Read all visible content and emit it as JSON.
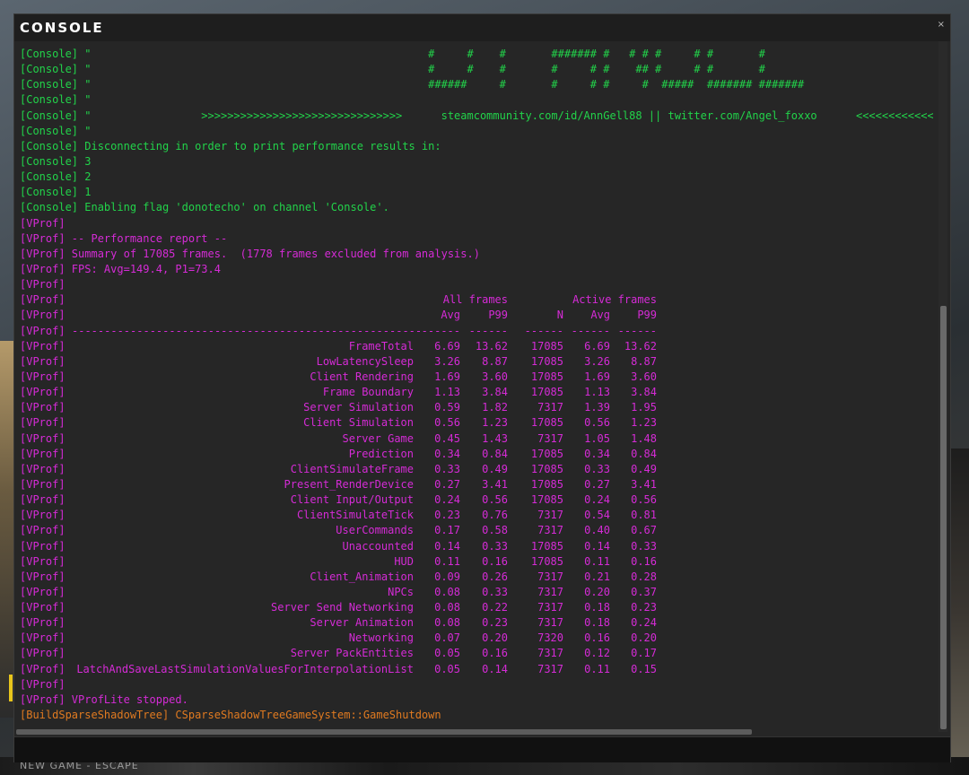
{
  "window": {
    "title": "CONSOLE",
    "close_glyph": "×"
  },
  "background": {
    "caption": "NEW GAME - ESCAPE"
  },
  "console_lines": [
    {
      "prefix": "[Console]",
      "text": " \"                                                    #     #    #       ####### #   # # #     # #       #",
      "color": "green"
    },
    {
      "prefix": "[Console]",
      "text": " \"                                                    #     #    #       #     # #    ## #     # #       #",
      "color": "green"
    },
    {
      "prefix": "[Console]",
      "text": " \"                                                    ######     #       #     # #     #  #####  ####### #######",
      "color": "green"
    },
    {
      "prefix": "[Console]",
      "text": " \"",
      "color": "green"
    },
    {
      "prefix": "[Console]",
      "text": " \"                 >>>>>>>>>>>>>>>>>>>>>>>>>>>>>>>      steamcommunity.com/id/AnnGell88 || twitter.com/Angel_foxxo      <<<<<<<<<<<<",
      "color": "green"
    },
    {
      "prefix": "[Console]",
      "text": " \"",
      "color": "green"
    },
    {
      "prefix": "[Console]",
      "text": " Disconnecting in order to print performance results in:",
      "color": "green"
    },
    {
      "prefix": "[Console]",
      "text": " 3",
      "color": "green"
    },
    {
      "prefix": "[Console]",
      "text": " 2",
      "color": "green"
    },
    {
      "prefix": "[Console]",
      "text": " 1",
      "color": "green"
    },
    {
      "prefix": "[Console]",
      "text": " Enabling flag 'donotecho' on channel 'Console'.",
      "color": "green"
    },
    {
      "prefix": "[VProf]",
      "text": "",
      "color": "mag"
    },
    {
      "prefix": "[VProf]",
      "text": " -- Performance report --",
      "color": "mag"
    },
    {
      "prefix": "[VProf]",
      "text": " Summary of 17085 frames.  (1778 frames excluded from analysis.)",
      "color": "mag"
    },
    {
      "prefix": "[VProf]",
      "text": " FPS: Avg=149.4, P1=73.4",
      "color": "mag"
    },
    {
      "prefix": "[VProf]",
      "text": "",
      "color": "mag"
    }
  ],
  "table": {
    "group_all": "All frames",
    "group_active": "Active frames",
    "headers": [
      "Avg",
      "P99",
      "N",
      "Avg",
      "P99"
    ],
    "separator_name": "------------------------------------------------------",
    "separator_col": "------",
    "rows": [
      {
        "name": "FrameTotal",
        "all_avg": "6.69",
        "all_p99": "13.62",
        "n": "17085",
        "act_avg": "6.69",
        "act_p99": "13.62"
      },
      {
        "name": "LowLatencySleep",
        "all_avg": "3.26",
        "all_p99": "8.87",
        "n": "17085",
        "act_avg": "3.26",
        "act_p99": "8.87"
      },
      {
        "name": "Client Rendering",
        "all_avg": "1.69",
        "all_p99": "3.60",
        "n": "17085",
        "act_avg": "1.69",
        "act_p99": "3.60"
      },
      {
        "name": "Frame Boundary",
        "all_avg": "1.13",
        "all_p99": "3.84",
        "n": "17085",
        "act_avg": "1.13",
        "act_p99": "3.84"
      },
      {
        "name": "Server Simulation",
        "all_avg": "0.59",
        "all_p99": "1.82",
        "n": "7317",
        "act_avg": "1.39",
        "act_p99": "1.95"
      },
      {
        "name": "Client Simulation",
        "all_avg": "0.56",
        "all_p99": "1.23",
        "n": "17085",
        "act_avg": "0.56",
        "act_p99": "1.23"
      },
      {
        "name": "Server Game",
        "all_avg": "0.45",
        "all_p99": "1.43",
        "n": "7317",
        "act_avg": "1.05",
        "act_p99": "1.48"
      },
      {
        "name": "Prediction",
        "all_avg": "0.34",
        "all_p99": "0.84",
        "n": "17085",
        "act_avg": "0.34",
        "act_p99": "0.84"
      },
      {
        "name": "ClientSimulateFrame",
        "all_avg": "0.33",
        "all_p99": "0.49",
        "n": "17085",
        "act_avg": "0.33",
        "act_p99": "0.49"
      },
      {
        "name": "Present_RenderDevice",
        "all_avg": "0.27",
        "all_p99": "3.41",
        "n": "17085",
        "act_avg": "0.27",
        "act_p99": "3.41"
      },
      {
        "name": "Client Input/Output",
        "all_avg": "0.24",
        "all_p99": "0.56",
        "n": "17085",
        "act_avg": "0.24",
        "act_p99": "0.56"
      },
      {
        "name": "ClientSimulateTick",
        "all_avg": "0.23",
        "all_p99": "0.76",
        "n": "7317",
        "act_avg": "0.54",
        "act_p99": "0.81"
      },
      {
        "name": "UserCommands",
        "all_avg": "0.17",
        "all_p99": "0.58",
        "n": "7317",
        "act_avg": "0.40",
        "act_p99": "0.67"
      },
      {
        "name": "Unaccounted",
        "all_avg": "0.14",
        "all_p99": "0.33",
        "n": "17085",
        "act_avg": "0.14",
        "act_p99": "0.33"
      },
      {
        "name": "HUD",
        "all_avg": "0.11",
        "all_p99": "0.16",
        "n": "17085",
        "act_avg": "0.11",
        "act_p99": "0.16"
      },
      {
        "name": "Client_Animation",
        "all_avg": "0.09",
        "all_p99": "0.26",
        "n": "7317",
        "act_avg": "0.21",
        "act_p99": "0.28"
      },
      {
        "name": "NPCs",
        "all_avg": "0.08",
        "all_p99": "0.33",
        "n": "7317",
        "act_avg": "0.20",
        "act_p99": "0.37"
      },
      {
        "name": "Server Send Networking",
        "all_avg": "0.08",
        "all_p99": "0.22",
        "n": "7317",
        "act_avg": "0.18",
        "act_p99": "0.23"
      },
      {
        "name": "Server Animation",
        "all_avg": "0.08",
        "all_p99": "0.23",
        "n": "7317",
        "act_avg": "0.18",
        "act_p99": "0.24"
      },
      {
        "name": "Networking",
        "all_avg": "0.07",
        "all_p99": "0.20",
        "n": "7320",
        "act_avg": "0.16",
        "act_p99": "0.20"
      },
      {
        "name": "Server PackEntities",
        "all_avg": "0.05",
        "all_p99": "0.16",
        "n": "7317",
        "act_avg": "0.12",
        "act_p99": "0.17"
      },
      {
        "name": "LatchAndSaveLastSimulationValuesForInterpolationList",
        "all_avg": "0.05",
        "all_p99": "0.14",
        "n": "7317",
        "act_avg": "0.11",
        "act_p99": "0.15"
      }
    ]
  },
  "footer_lines": [
    {
      "prefix": "[VProf]",
      "text": "",
      "color": "mag"
    },
    {
      "prefix": "[VProf]",
      "text": " VProfLite stopped.",
      "color": "mag"
    },
    {
      "prefix": "[BuildSparseShadowTree]",
      "text": " CSparseShadowTreeGameSystem::GameShutdown",
      "color": "orange"
    }
  ],
  "colors": {
    "green": "#22d34a",
    "magenta": "#d52bd6",
    "orange": "#e07a20"
  },
  "input": {
    "value": ""
  }
}
